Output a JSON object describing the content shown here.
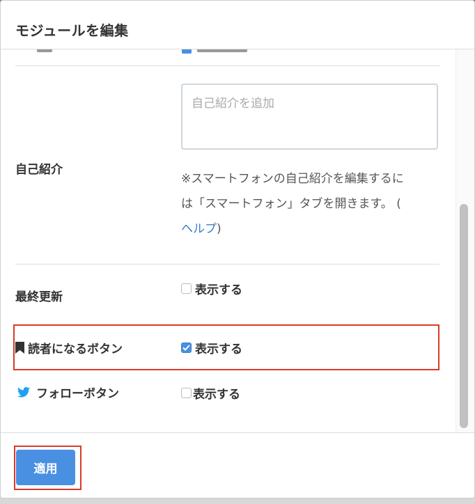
{
  "modal": {
    "title": "モジュールを編集"
  },
  "self_intro": {
    "label": "自己紹介",
    "placeholder": "自己紹介を追加",
    "note_line1": "※スマートフォンの自己紹介を編集するに",
    "note_line2": "は「スマートフォン」タブを開きます。 (",
    "note_link": "ヘルプ",
    "note_close": ")"
  },
  "last_updated": {
    "label": "最終更新",
    "option_label": "表示する",
    "checked": false
  },
  "reader_button": {
    "label": "読者になるボタン",
    "option_label": "表示する",
    "checked": true
  },
  "follow_button": {
    "label": "フォローボタン",
    "option_label": "表示する",
    "checked": false
  },
  "footer": {
    "apply_label": "適用"
  },
  "colors": {
    "accent": "#4a90e2",
    "highlight": "#d9392a",
    "twitter": "#1da1f2",
    "link": "#3a80c3"
  }
}
